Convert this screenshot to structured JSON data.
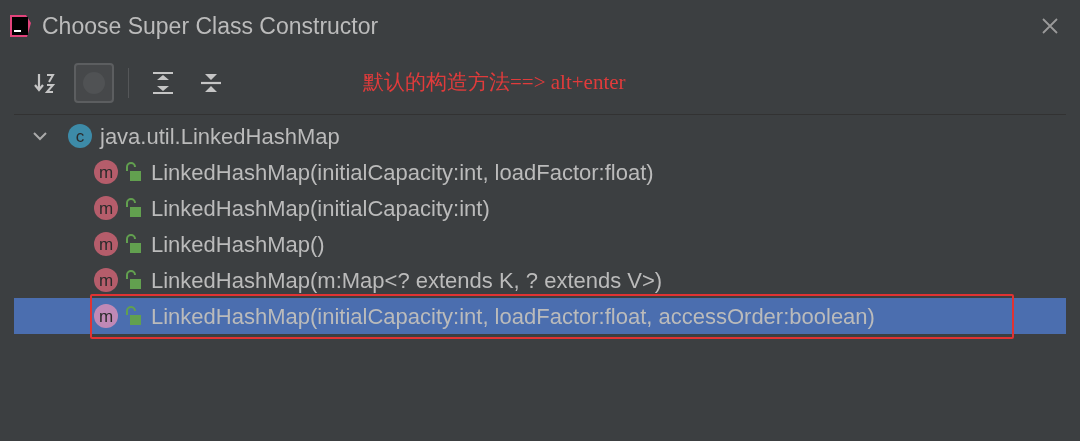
{
  "window": {
    "title": "Choose Super Class Constructor"
  },
  "toolbar": {
    "buttons": [
      {
        "kind": "sort",
        "pressed": false
      },
      {
        "kind": "inherited",
        "pressed": true
      },
      {
        "kind": "expand",
        "pressed": false
      },
      {
        "kind": "collapse",
        "pressed": false
      }
    ]
  },
  "annotation": {
    "text": "默认的构造方法==> alt+enter"
  },
  "tree": {
    "root": {
      "label": "java.util.LinkedHashMap",
      "badge": "c",
      "expanded": true,
      "children": [
        {
          "label": "LinkedHashMap(initialCapacity:int, loadFactor:float)",
          "badge": "m",
          "selected": false,
          "boxed": false
        },
        {
          "label": "LinkedHashMap(initialCapacity:int)",
          "badge": "m",
          "selected": false,
          "boxed": false
        },
        {
          "label": "LinkedHashMap()",
          "badge": "m",
          "selected": false,
          "boxed": false
        },
        {
          "label": "LinkedHashMap(m:Map<? extends K, ? extends V>)",
          "badge": "m",
          "selected": false,
          "boxed": false
        },
        {
          "label": "LinkedHashMap(initialCapacity:int, loadFactor:float, accessOrder:boolean)",
          "badge": "m",
          "selected": true,
          "boxed": true
        }
      ]
    }
  }
}
